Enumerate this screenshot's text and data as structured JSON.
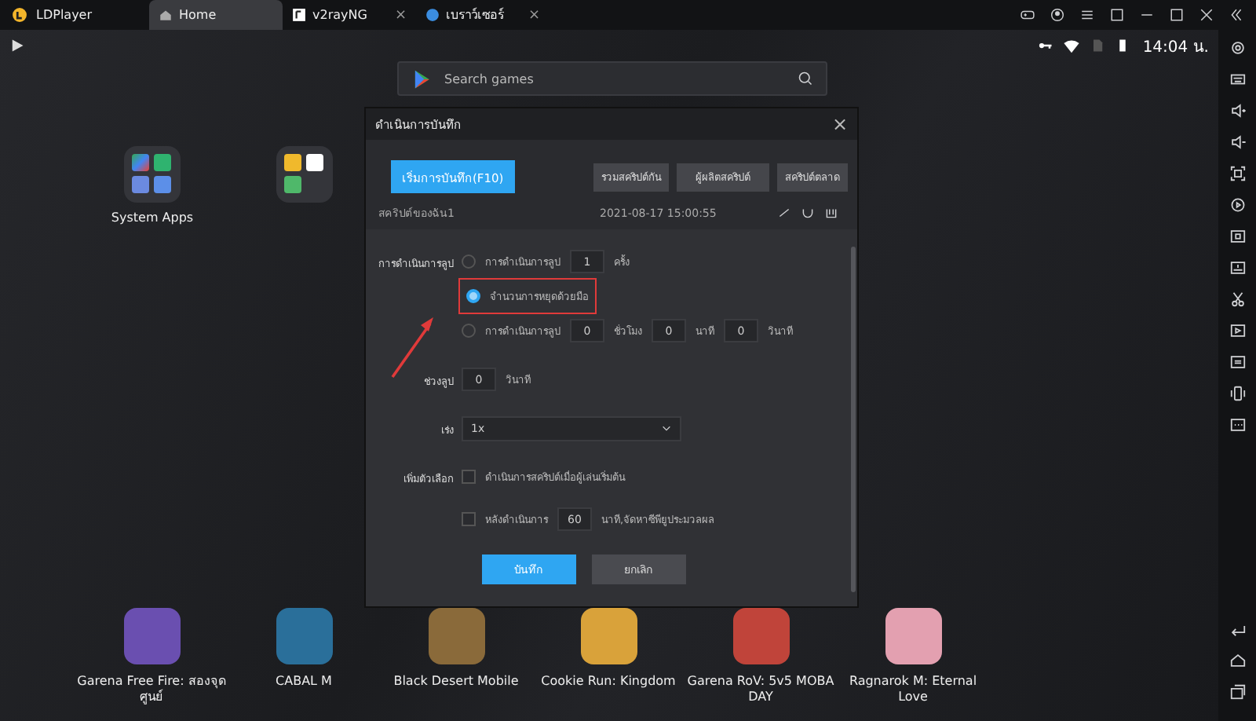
{
  "app": {
    "name": "LDPlayer"
  },
  "tabs": [
    {
      "label": "Home",
      "selected": true
    },
    {
      "label": "v2rayNG",
      "selected": false,
      "close": "×"
    },
    {
      "label": "เบราว์เซอร์",
      "selected": false,
      "close": "×"
    }
  ],
  "status_bar": {
    "time": "14:04 น."
  },
  "search": {
    "placeholder": "Search games"
  },
  "folders": [
    {
      "kind": "system",
      "label": "System Apps"
    },
    {
      "kind": "games"
    }
  ],
  "games": [
    {
      "label": "Garena Free Fire: สองจุด ศูนย์",
      "color": "#6a4fb0"
    },
    {
      "label": "CABAL M",
      "color": "#2a6f9a"
    },
    {
      "label": "Black Desert Mobile",
      "color": "#8a6a3a"
    },
    {
      "label": "Cookie Run: Kingdom",
      "color": "#d9a23a"
    },
    {
      "label": "Garena RoV: 5v5 MOBA DAY",
      "color": "#c0443a"
    },
    {
      "label": "Ragnarok M: Eternal Love",
      "color": "#e3a0b0"
    }
  ],
  "dialog": {
    "title": "ดำเนินการบันทึก",
    "close": "×",
    "primary_button": "เริ่มการบันทึก(F10)",
    "tool_buttons": [
      "รวมสคริปต์กัน",
      "ผู้ผลิตสคริปต์",
      "สคริปต์ตลาด"
    ],
    "script": {
      "name": "สคริปต์ของฉัน1",
      "date": "2021-08-17 15:00:55"
    },
    "loop_label": "การดำเนินการลูป",
    "loop_options": [
      {
        "selected": false,
        "annotated": false,
        "parts": [
          {
            "kind": "text",
            "text": "การดำเนินการลูป"
          },
          {
            "kind": "input",
            "value": "1"
          },
          {
            "kind": "text",
            "text": "ครั้ง"
          }
        ]
      },
      {
        "selected": true,
        "annotated": true,
        "parts": [
          {
            "kind": "text",
            "text": "จำนวนการหยุดด้วยมือ"
          }
        ]
      },
      {
        "selected": false,
        "annotated": false,
        "parts": [
          {
            "kind": "text",
            "text": "การดำเนินการลูป"
          },
          {
            "kind": "input",
            "value": "0"
          },
          {
            "kind": "text",
            "text": "ชั่วโมง"
          },
          {
            "kind": "input",
            "value": "0"
          },
          {
            "kind": "text",
            "text": "นาที"
          },
          {
            "kind": "input",
            "value": "0"
          },
          {
            "kind": "text",
            "text": "วินาที"
          }
        ]
      }
    ],
    "interval_label": "ช่วงลูป",
    "interval_value": "0",
    "interval_unit": "วินาที",
    "speed_label": "เร่ง",
    "speed_value": "1x",
    "options_label": "เพิ่มตัวเลือก",
    "options": [
      {
        "checked": false,
        "parts": [
          {
            "kind": "text",
            "text": "ดำเนินการสคริปต์เมื่อผู้เล่นเริ่มต้น"
          }
        ]
      },
      {
        "checked": false,
        "parts": [
          {
            "kind": "text",
            "text": "หลังดำเนินการ"
          },
          {
            "kind": "input",
            "value": "60"
          },
          {
            "kind": "text",
            "text": "นาที,จัดหาซีพียูประมวลผล"
          }
        ]
      }
    ],
    "save_button": "บันทึก",
    "cancel_button": "ยกเลิก"
  }
}
